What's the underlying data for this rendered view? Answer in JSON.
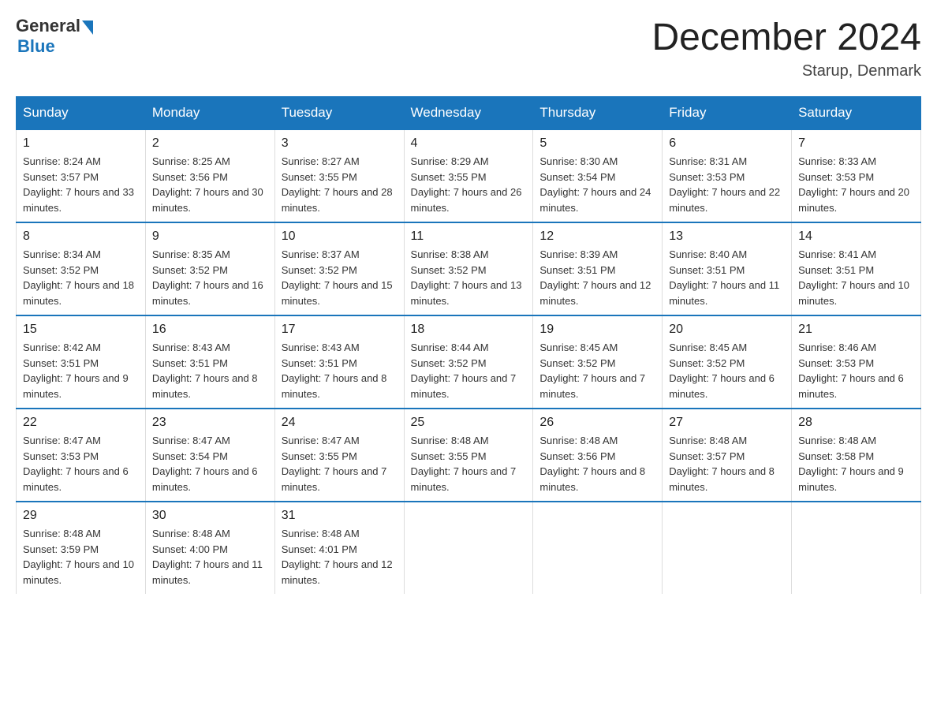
{
  "header": {
    "logo_general": "General",
    "logo_blue": "Blue",
    "month_title": "December 2024",
    "location": "Starup, Denmark"
  },
  "days_of_week": [
    "Sunday",
    "Monday",
    "Tuesday",
    "Wednesday",
    "Thursday",
    "Friday",
    "Saturday"
  ],
  "weeks": [
    [
      {
        "num": "1",
        "sunrise": "8:24 AM",
        "sunset": "3:57 PM",
        "daylight": "7 hours and 33 minutes."
      },
      {
        "num": "2",
        "sunrise": "8:25 AM",
        "sunset": "3:56 PM",
        "daylight": "7 hours and 30 minutes."
      },
      {
        "num": "3",
        "sunrise": "8:27 AM",
        "sunset": "3:55 PM",
        "daylight": "7 hours and 28 minutes."
      },
      {
        "num": "4",
        "sunrise": "8:29 AM",
        "sunset": "3:55 PM",
        "daylight": "7 hours and 26 minutes."
      },
      {
        "num": "5",
        "sunrise": "8:30 AM",
        "sunset": "3:54 PM",
        "daylight": "7 hours and 24 minutes."
      },
      {
        "num": "6",
        "sunrise": "8:31 AM",
        "sunset": "3:53 PM",
        "daylight": "7 hours and 22 minutes."
      },
      {
        "num": "7",
        "sunrise": "8:33 AM",
        "sunset": "3:53 PM",
        "daylight": "7 hours and 20 minutes."
      }
    ],
    [
      {
        "num": "8",
        "sunrise": "8:34 AM",
        "sunset": "3:52 PM",
        "daylight": "7 hours and 18 minutes."
      },
      {
        "num": "9",
        "sunrise": "8:35 AM",
        "sunset": "3:52 PM",
        "daylight": "7 hours and 16 minutes."
      },
      {
        "num": "10",
        "sunrise": "8:37 AM",
        "sunset": "3:52 PM",
        "daylight": "7 hours and 15 minutes."
      },
      {
        "num": "11",
        "sunrise": "8:38 AM",
        "sunset": "3:52 PM",
        "daylight": "7 hours and 13 minutes."
      },
      {
        "num": "12",
        "sunrise": "8:39 AM",
        "sunset": "3:51 PM",
        "daylight": "7 hours and 12 minutes."
      },
      {
        "num": "13",
        "sunrise": "8:40 AM",
        "sunset": "3:51 PM",
        "daylight": "7 hours and 11 minutes."
      },
      {
        "num": "14",
        "sunrise": "8:41 AM",
        "sunset": "3:51 PM",
        "daylight": "7 hours and 10 minutes."
      }
    ],
    [
      {
        "num": "15",
        "sunrise": "8:42 AM",
        "sunset": "3:51 PM",
        "daylight": "7 hours and 9 minutes."
      },
      {
        "num": "16",
        "sunrise": "8:43 AM",
        "sunset": "3:51 PM",
        "daylight": "7 hours and 8 minutes."
      },
      {
        "num": "17",
        "sunrise": "8:43 AM",
        "sunset": "3:51 PM",
        "daylight": "7 hours and 8 minutes."
      },
      {
        "num": "18",
        "sunrise": "8:44 AM",
        "sunset": "3:52 PM",
        "daylight": "7 hours and 7 minutes."
      },
      {
        "num": "19",
        "sunrise": "8:45 AM",
        "sunset": "3:52 PM",
        "daylight": "7 hours and 7 minutes."
      },
      {
        "num": "20",
        "sunrise": "8:45 AM",
        "sunset": "3:52 PM",
        "daylight": "7 hours and 6 minutes."
      },
      {
        "num": "21",
        "sunrise": "8:46 AM",
        "sunset": "3:53 PM",
        "daylight": "7 hours and 6 minutes."
      }
    ],
    [
      {
        "num": "22",
        "sunrise": "8:47 AM",
        "sunset": "3:53 PM",
        "daylight": "7 hours and 6 minutes."
      },
      {
        "num": "23",
        "sunrise": "8:47 AM",
        "sunset": "3:54 PM",
        "daylight": "7 hours and 6 minutes."
      },
      {
        "num": "24",
        "sunrise": "8:47 AM",
        "sunset": "3:55 PM",
        "daylight": "7 hours and 7 minutes."
      },
      {
        "num": "25",
        "sunrise": "8:48 AM",
        "sunset": "3:55 PM",
        "daylight": "7 hours and 7 minutes."
      },
      {
        "num": "26",
        "sunrise": "8:48 AM",
        "sunset": "3:56 PM",
        "daylight": "7 hours and 8 minutes."
      },
      {
        "num": "27",
        "sunrise": "8:48 AM",
        "sunset": "3:57 PM",
        "daylight": "7 hours and 8 minutes."
      },
      {
        "num": "28",
        "sunrise": "8:48 AM",
        "sunset": "3:58 PM",
        "daylight": "7 hours and 9 minutes."
      }
    ],
    [
      {
        "num": "29",
        "sunrise": "8:48 AM",
        "sunset": "3:59 PM",
        "daylight": "7 hours and 10 minutes."
      },
      {
        "num": "30",
        "sunrise": "8:48 AM",
        "sunset": "4:00 PM",
        "daylight": "7 hours and 11 minutes."
      },
      {
        "num": "31",
        "sunrise": "8:48 AM",
        "sunset": "4:01 PM",
        "daylight": "7 hours and 12 minutes."
      },
      null,
      null,
      null,
      null
    ]
  ]
}
